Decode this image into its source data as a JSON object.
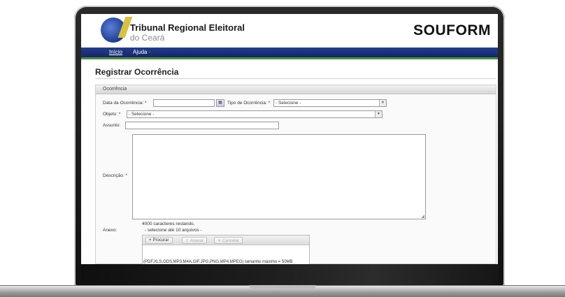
{
  "header": {
    "org_name": "Tribunal Regional Eleitoral",
    "org_sub": "do Ceará",
    "app_name": "SOUFORM",
    "logo_colors": {
      "globe": "#1d3a93",
      "accent": "#d8c23a"
    }
  },
  "nav": {
    "items": [
      {
        "label": "Início"
      },
      {
        "label": "Ajuda ·"
      }
    ],
    "bar_color": "#1b2f7a",
    "accent_color": "#4d8f3a"
  },
  "page": {
    "title": "Registrar Ocorrência"
  },
  "form": {
    "section_title": "Ocorrência",
    "date_label": "Data da Ocorrência: *",
    "date_value": "",
    "type_label": "Tipo de Ocorrência: *",
    "type_selected": "- Selecione -",
    "object_label": "Objeto: *",
    "object_selected": "- Selecione -",
    "subject_label": "Assunto:",
    "subject_value": "",
    "description_label": "Descrição: *",
    "description_value": "",
    "chars_remaining": "4000 caracteres restando.",
    "attachment_label": "Anexo:",
    "attachment_hint": "- selecione até 10 arquivos -",
    "upload": {
      "browse_label": "Procurar",
      "attach_label": "Anexar",
      "cancel_label": "Cancelar",
      "formats_note": "(PDF,XLS,ODS,MP3,M4A,GIF,JPG,PNG,MP4,MPEG) tamanho máximo = 50MB"
    }
  }
}
